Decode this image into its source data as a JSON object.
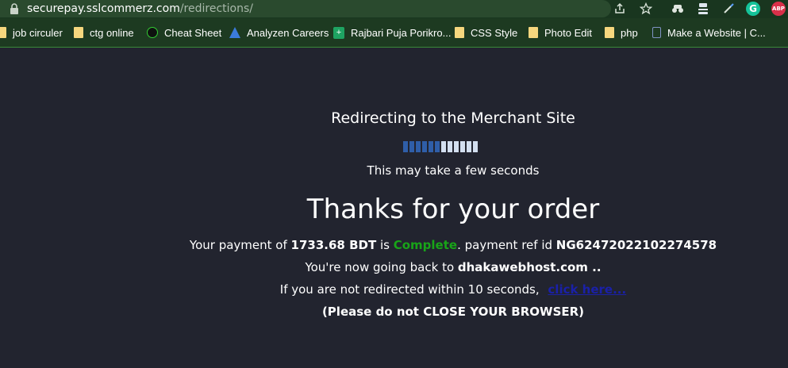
{
  "browser": {
    "url_host": "securepay.sslcommerz.com",
    "url_path": "/redirections/",
    "icons": [
      "share-icon",
      "star-icon",
      "extension-icon",
      "profile-icon",
      "pen-icon",
      "grammarly-icon",
      "adblock-icon"
    ],
    "adblock_label": "ABP",
    "grammarly_label": "G"
  },
  "bookmarks": [
    {
      "label": "job circuler",
      "icon": "folder-icon"
    },
    {
      "label": "ctg online",
      "icon": "folder-icon"
    },
    {
      "label": "Cheat Sheet",
      "icon": "cheat-sheet-icon"
    },
    {
      "label": "Analyzen Careers",
      "icon": "analyzen-icon"
    },
    {
      "label": "Rajbari Puja Porikro...",
      "icon": "sheets-icon"
    },
    {
      "label": "CSS Style",
      "icon": "folder-icon"
    },
    {
      "label": "Photo Edit",
      "icon": "folder-icon"
    },
    {
      "label": "php",
      "icon": "folder-icon"
    },
    {
      "label": "Make a Website | C...",
      "icon": "document-icon"
    }
  ],
  "page": {
    "redirect_title": "Redirecting to the Merchant Site",
    "progress_fraction": 0.5,
    "progress_segments": 12,
    "wait_text": "This may take a few seconds",
    "thanks": "Thanks for your order",
    "payment_prefix": "Your payment of ",
    "amount": "1733.68 BDT",
    "is_text": " is ",
    "status": "Complete",
    "ref_text": ". payment ref id ",
    "ref_id": "NG62472022102274578",
    "back_prefix": "You're now going back to ",
    "merchant": "dhakawebhost.com ..",
    "not_redirected": "If you are not redirected within 10 seconds,",
    "click_here": "click here...",
    "warning": "(Please do not CLOSE YOUR BROWSER)"
  },
  "colors": {
    "page_bg": "#22242f",
    "progress_filled": "#2f5ea8",
    "progress_empty": "#d3dff0",
    "status_green": "#18a418",
    "link_blue": "#1a20a8"
  }
}
